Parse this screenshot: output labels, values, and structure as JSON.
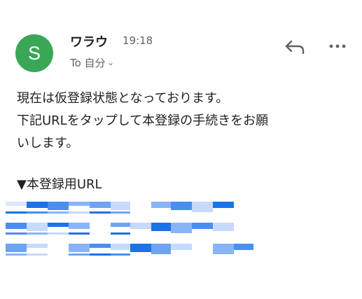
{
  "header": {
    "avatar_letter": "S",
    "sender": "ワラウ",
    "time": "19:18",
    "to_line": "To 自分",
    "icons": [
      "reply-icon",
      "more-icon",
      "chevron-down-icon"
    ]
  },
  "body": {
    "line1": "現在は仮登録状態となっております。",
    "line2": "下記URLをタップして本登録の手続きをお願",
    "line3": "いします。",
    "link_heading": "▼本登録用URL"
  },
  "colors": {
    "avatar_bg": "#3aa757",
    "link_blue": "#1a73e8"
  }
}
